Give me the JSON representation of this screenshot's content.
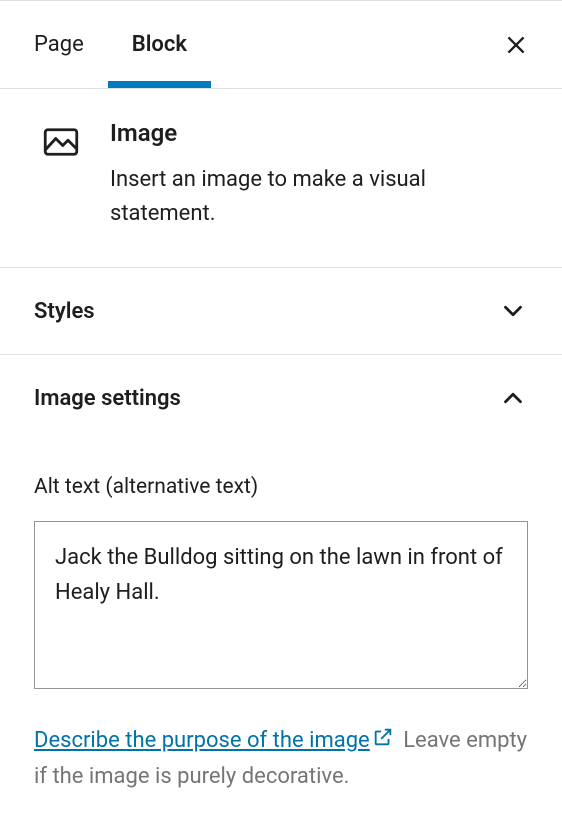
{
  "tabs": {
    "page": "Page",
    "block": "Block"
  },
  "block": {
    "title": "Image",
    "description": "Insert an image to make a visual statement."
  },
  "sections": {
    "styles": {
      "title": "Styles"
    },
    "imageSettings": {
      "title": "Image settings",
      "altLabel": "Alt text (alternative text)",
      "altValue": "Jack the Bulldog sitting on the lawn in front of Healy Hall.",
      "helpLinkText": "Describe the purpose of the image",
      "helpTrailing": " Leave empty if the image is purely decorative."
    }
  }
}
